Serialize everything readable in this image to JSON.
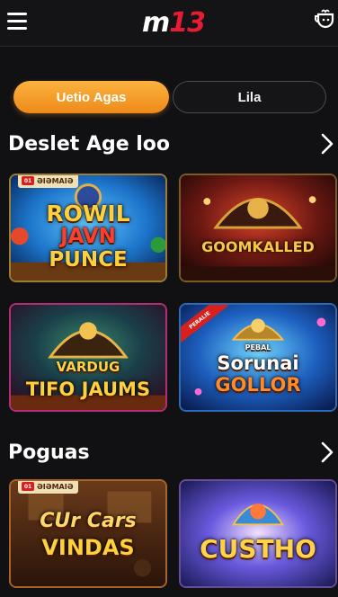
{
  "header": {
    "logo_m": "m",
    "logo_13": "13",
    "menu_icon": "hamburger-menu-icon",
    "right_icon": "trophy-cup-icon"
  },
  "tabs": [
    {
      "label": "Uetio Agas",
      "active": true
    },
    {
      "label": "Lila",
      "active": false
    }
  ],
  "sections": [
    {
      "title": "Deslet Age loo",
      "games": [
        {
          "title_lines": [
            "ROWIL",
            "JAVN",
            "PUNCE"
          ],
          "badge": "ƏIƏMAIƏ",
          "badge_dot": "01"
        },
        {
          "title_lines": [
            "GOOMKALLED"
          ]
        },
        {
          "title_lines": [
            "VARDUG",
            "TIFO JAUMS"
          ]
        },
        {
          "title_lines": [
            "PEBAL",
            "Sorunai",
            "GOLLOR"
          ],
          "ribbon": "PERALIE"
        }
      ]
    },
    {
      "title": "Poguas",
      "games": [
        {
          "title_lines": [
            "CUr Cars",
            "VINDAS"
          ],
          "badge": "ƏIƏMAIƏ",
          "badge_dot": "01"
        },
        {
          "title_lines": [
            "CUSTHO"
          ]
        }
      ]
    }
  ],
  "colors": {
    "accent": "#f3a02e",
    "brand_red": "#e81b36",
    "background": "#111114"
  }
}
